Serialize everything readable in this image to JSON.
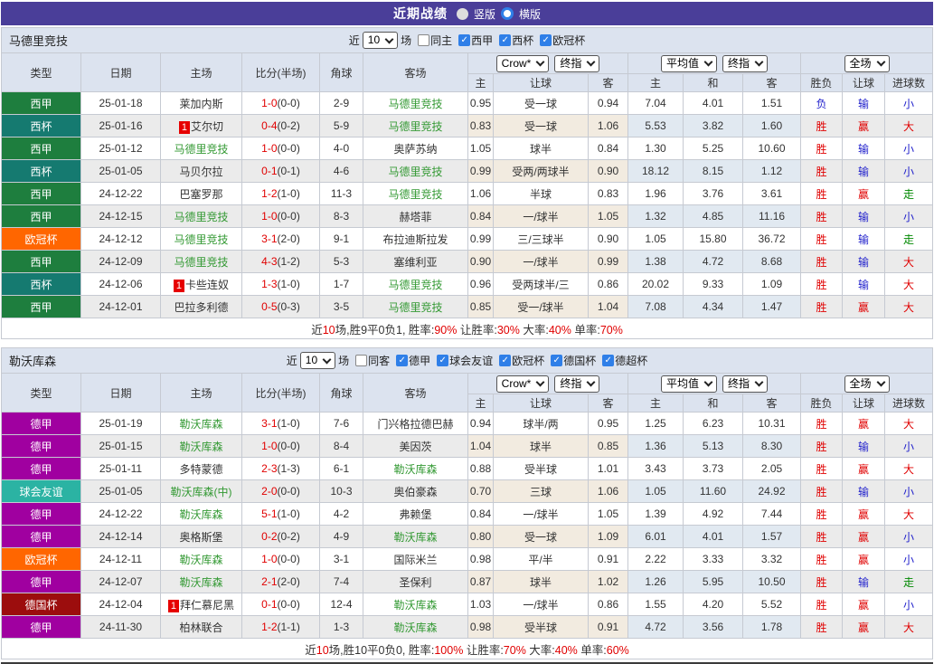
{
  "title_bar": {
    "title": "近期战绩",
    "options": [
      {
        "label": "竖版",
        "selected": false
      },
      {
        "label": "横版",
        "selected": true
      }
    ]
  },
  "colors": {
    "titlebar_bg": "#4a3e99",
    "accent_red": "#e00000",
    "accent_blue": "#2222cc",
    "accent_green": "#008800",
    "team_green": "#339933",
    "checkbox_blue": "#2f7fe8",
    "type_bg": {
      "西甲": "#1e7e3e",
      "西杯": "#157a70",
      "欧冠杯": "#ff6600",
      "德甲": "#a000a0",
      "球会友谊": "#2bb3a3",
      "德国杯": "#9c0d0d"
    }
  },
  "table_header": {
    "main_cols": [
      "类型",
      "日期",
      "主场",
      "比分(半场)",
      "角球",
      "客场"
    ],
    "groups": [
      {
        "dropdowns": [
          "Crow*",
          "终指"
        ],
        "sub": [
          "主",
          "让球",
          "客"
        ]
      },
      {
        "dropdowns": [
          "平均值",
          "终指"
        ],
        "sub": [
          "主",
          "和",
          "客"
        ]
      },
      {
        "dropdowns": [
          "全场"
        ],
        "sub": [
          "胜负",
          "让球",
          "进球数"
        ]
      }
    ]
  },
  "sections": [
    {
      "team": "马德里竞技",
      "filter": {
        "prefix": "近",
        "count": "10",
        "suffix": "场",
        "checkboxes": [
          {
            "label": "同主",
            "checked": false
          },
          {
            "label": "西甲",
            "checked": true
          },
          {
            "label": "西杯",
            "checked": true
          },
          {
            "label": "欧冠杯",
            "checked": true
          }
        ]
      },
      "rows": [
        {
          "type": "西甲",
          "date": "25-01-18",
          "home": "莱加内斯",
          "hb": 0,
          "hg": 0,
          "score": "1-0",
          "half": "(0-0)",
          "corner": "2-9",
          "away": "马德里竞技",
          "ag": 1,
          "o1": "0.95",
          "h": "受一球",
          "o2": "0.94",
          "a": [
            "7.04",
            "4.01",
            "1.51"
          ],
          "r": [
            "负",
            "输",
            "小"
          ],
          "rc": [
            "b",
            "b",
            "b"
          ]
        },
        {
          "type": "西杯",
          "date": "25-01-16",
          "home": "艾尔切",
          "hb": 1,
          "hg": 0,
          "score": "0-4",
          "half": "(0-2)",
          "corner": "5-9",
          "away": "马德里竞技",
          "ag": 1,
          "o1": "0.83",
          "h": "受一球",
          "o2": "1.06",
          "a": [
            "5.53",
            "3.82",
            "1.60"
          ],
          "r": [
            "胜",
            "赢",
            "大"
          ],
          "rc": [
            "r",
            "r",
            "r"
          ]
        },
        {
          "type": "西甲",
          "date": "25-01-12",
          "home": "马德里竞技",
          "hb": 0,
          "hg": 1,
          "score": "1-0",
          "half": "(0-0)",
          "corner": "4-0",
          "away": "奥萨苏纳",
          "ag": 0,
          "o1": "1.05",
          "h": "球半",
          "o2": "0.84",
          "a": [
            "1.30",
            "5.25",
            "10.60"
          ],
          "r": [
            "胜",
            "输",
            "小"
          ],
          "rc": [
            "r",
            "b",
            "b"
          ]
        },
        {
          "type": "西杯",
          "date": "25-01-05",
          "home": "马贝尔拉",
          "hb": 0,
          "hg": 0,
          "score": "0-1",
          "half": "(0-1)",
          "corner": "4-6",
          "away": "马德里竞技",
          "ag": 1,
          "o1": "0.99",
          "h": "受两/两球半",
          "o2": "0.90",
          "a": [
            "18.12",
            "8.15",
            "1.12"
          ],
          "r": [
            "胜",
            "输",
            "小"
          ],
          "rc": [
            "r",
            "b",
            "b"
          ]
        },
        {
          "type": "西甲",
          "date": "24-12-22",
          "home": "巴塞罗那",
          "hb": 0,
          "hg": 0,
          "score": "1-2",
          "half": "(1-0)",
          "corner": "11-3",
          "away": "马德里竞技",
          "ag": 1,
          "o1": "1.06",
          "h": "半球",
          "o2": "0.83",
          "a": [
            "1.96",
            "3.76",
            "3.61"
          ],
          "r": [
            "胜",
            "赢",
            "走"
          ],
          "rc": [
            "r",
            "r",
            "g"
          ]
        },
        {
          "type": "西甲",
          "date": "24-12-15",
          "home": "马德里竞技",
          "hb": 0,
          "hg": 1,
          "score": "1-0",
          "half": "(0-0)",
          "corner": "8-3",
          "away": "赫塔菲",
          "ag": 0,
          "o1": "0.84",
          "h": "一/球半",
          "o2": "1.05",
          "a": [
            "1.32",
            "4.85",
            "11.16"
          ],
          "r": [
            "胜",
            "输",
            "小"
          ],
          "rc": [
            "r",
            "b",
            "b"
          ]
        },
        {
          "type": "欧冠杯",
          "date": "24-12-12",
          "home": "马德里竞技",
          "hb": 0,
          "hg": 1,
          "score": "3-1",
          "half": "(2-0)",
          "corner": "9-1",
          "away": "布拉迪斯拉发",
          "ag": 0,
          "o1": "0.99",
          "h": "三/三球半",
          "o2": "0.90",
          "a": [
            "1.05",
            "15.80",
            "36.72"
          ],
          "r": [
            "胜",
            "输",
            "走"
          ],
          "rc": [
            "r",
            "b",
            "g"
          ]
        },
        {
          "type": "西甲",
          "date": "24-12-09",
          "home": "马德里竞技",
          "hb": 0,
          "hg": 1,
          "score": "4-3",
          "half": "(1-2)",
          "corner": "5-3",
          "away": "塞维利亚",
          "ag": 0,
          "o1": "0.90",
          "h": "一/球半",
          "o2": "0.99",
          "a": [
            "1.38",
            "4.72",
            "8.68"
          ],
          "r": [
            "胜",
            "输",
            "大"
          ],
          "rc": [
            "r",
            "b",
            "r"
          ]
        },
        {
          "type": "西杯",
          "date": "24-12-06",
          "home": "卡些连奴",
          "hb": 1,
          "hg": 0,
          "score": "1-3",
          "half": "(1-0)",
          "corner": "1-7",
          "away": "马德里竞技",
          "ag": 1,
          "o1": "0.96",
          "h": "受两球半/三",
          "o2": "0.86",
          "a": [
            "20.02",
            "9.33",
            "1.09"
          ],
          "r": [
            "胜",
            "输",
            "大"
          ],
          "rc": [
            "r",
            "b",
            "r"
          ]
        },
        {
          "type": "西甲",
          "date": "24-12-01",
          "home": "巴拉多利德",
          "hb": 0,
          "hg": 0,
          "score": "0-5",
          "half": "(0-3)",
          "corner": "3-5",
          "away": "马德里竞技",
          "ag": 1,
          "o1": "0.85",
          "h": "受一/球半",
          "o2": "1.04",
          "a": [
            "7.08",
            "4.34",
            "1.47"
          ],
          "r": [
            "胜",
            "赢",
            "大"
          ],
          "rc": [
            "r",
            "r",
            "r"
          ]
        }
      ],
      "summary": [
        [
          "近",
          "k"
        ],
        [
          "10",
          "r"
        ],
        [
          "场,胜9平0负1, 胜率:",
          "k"
        ],
        [
          "90%",
          "r"
        ],
        [
          " 让胜率:",
          "k"
        ],
        [
          "30%",
          "r"
        ],
        [
          " 大率:",
          "k"
        ],
        [
          "40%",
          "r"
        ],
        [
          " 单率:",
          "k"
        ],
        [
          "70%",
          "r"
        ]
      ]
    },
    {
      "team": "勒沃库森",
      "filter": {
        "prefix": "近",
        "count": "10",
        "suffix": "场",
        "checkboxes": [
          {
            "label": "同客",
            "checked": false
          },
          {
            "label": "德甲",
            "checked": true
          },
          {
            "label": "球会友谊",
            "checked": true
          },
          {
            "label": "欧冠杯",
            "checked": true
          },
          {
            "label": "德国杯",
            "checked": true
          },
          {
            "label": "德超杯",
            "checked": true
          }
        ]
      },
      "rows": [
        {
          "type": "德甲",
          "date": "25-01-19",
          "home": "勒沃库森",
          "hb": 0,
          "hg": 1,
          "score": "3-1",
          "half": "(1-0)",
          "corner": "7-6",
          "away": "门兴格拉德巴赫",
          "ag": 0,
          "o1": "0.94",
          "h": "球半/两",
          "o2": "0.95",
          "a": [
            "1.25",
            "6.23",
            "10.31"
          ],
          "r": [
            "胜",
            "赢",
            "大"
          ],
          "rc": [
            "r",
            "r",
            "r"
          ]
        },
        {
          "type": "德甲",
          "date": "25-01-15",
          "home": "勒沃库森",
          "hb": 0,
          "hg": 1,
          "score": "1-0",
          "half": "(0-0)",
          "corner": "8-4",
          "away": "美因茨",
          "ag": 0,
          "o1": "1.04",
          "h": "球半",
          "o2": "0.85",
          "a": [
            "1.36",
            "5.13",
            "8.30"
          ],
          "r": [
            "胜",
            "输",
            "小"
          ],
          "rc": [
            "r",
            "b",
            "b"
          ]
        },
        {
          "type": "德甲",
          "date": "25-01-11",
          "home": "多特蒙德",
          "hb": 0,
          "hg": 0,
          "score": "2-3",
          "half": "(1-3)",
          "corner": "6-1",
          "away": "勒沃库森",
          "ag": 1,
          "o1": "0.88",
          "h": "受半球",
          "o2": "1.01",
          "a": [
            "3.43",
            "3.73",
            "2.05"
          ],
          "r": [
            "胜",
            "赢",
            "大"
          ],
          "rc": [
            "r",
            "r",
            "r"
          ]
        },
        {
          "type": "球会友谊",
          "date": "25-01-05",
          "home": "勒沃库森(中)",
          "hb": 0,
          "hg": 1,
          "score": "2-0",
          "half": "(0-0)",
          "corner": "10-3",
          "away": "奥伯豪森",
          "ag": 0,
          "o1": "0.70",
          "h": "三球",
          "o2": "1.06",
          "a": [
            "1.05",
            "11.60",
            "24.92"
          ],
          "r": [
            "胜",
            "输",
            "小"
          ],
          "rc": [
            "r",
            "b",
            "b"
          ]
        },
        {
          "type": "德甲",
          "date": "24-12-22",
          "home": "勒沃库森",
          "hb": 0,
          "hg": 1,
          "score": "5-1",
          "half": "(1-0)",
          "corner": "4-2",
          "away": "弗赖堡",
          "ag": 0,
          "o1": "0.84",
          "h": "一/球半",
          "o2": "1.05",
          "a": [
            "1.39",
            "4.92",
            "7.44"
          ],
          "r": [
            "胜",
            "赢",
            "大"
          ],
          "rc": [
            "r",
            "r",
            "r"
          ]
        },
        {
          "type": "德甲",
          "date": "24-12-14",
          "home": "奥格斯堡",
          "hb": 0,
          "hg": 0,
          "score": "0-2",
          "half": "(0-2)",
          "corner": "4-9",
          "away": "勒沃库森",
          "ag": 1,
          "o1": "0.80",
          "h": "受一球",
          "o2": "1.09",
          "a": [
            "6.01",
            "4.01",
            "1.57"
          ],
          "r": [
            "胜",
            "赢",
            "小"
          ],
          "rc": [
            "r",
            "r",
            "b"
          ]
        },
        {
          "type": "欧冠杯",
          "date": "24-12-11",
          "home": "勒沃库森",
          "hb": 0,
          "hg": 1,
          "score": "1-0",
          "half": "(0-0)",
          "corner": "3-1",
          "away": "国际米兰",
          "ag": 0,
          "o1": "0.98",
          "h": "平/半",
          "o2": "0.91",
          "a": [
            "2.22",
            "3.33",
            "3.32"
          ],
          "r": [
            "胜",
            "赢",
            "小"
          ],
          "rc": [
            "r",
            "r",
            "b"
          ]
        },
        {
          "type": "德甲",
          "date": "24-12-07",
          "home": "勒沃库森",
          "hb": 0,
          "hg": 1,
          "score": "2-1",
          "half": "(2-0)",
          "corner": "7-4",
          "away": "圣保利",
          "ag": 0,
          "o1": "0.87",
          "h": "球半",
          "o2": "1.02",
          "a": [
            "1.26",
            "5.95",
            "10.50"
          ],
          "r": [
            "胜",
            "输",
            "走"
          ],
          "rc": [
            "r",
            "b",
            "g"
          ]
        },
        {
          "type": "德国杯",
          "date": "24-12-04",
          "home": "拜仁慕尼黑",
          "hb": 1,
          "hg": 0,
          "score": "0-1",
          "half": "(0-0)",
          "corner": "12-4",
          "away": "勒沃库森",
          "ag": 1,
          "o1": "1.03",
          "h": "一/球半",
          "o2": "0.86",
          "a": [
            "1.55",
            "4.20",
            "5.52"
          ],
          "r": [
            "胜",
            "赢",
            "小"
          ],
          "rc": [
            "r",
            "r",
            "b"
          ]
        },
        {
          "type": "德甲",
          "date": "24-11-30",
          "home": "柏林联合",
          "hb": 0,
          "hg": 0,
          "score": "1-2",
          "half": "(1-1)",
          "corner": "1-3",
          "away": "勒沃库森",
          "ag": 1,
          "o1": "0.98",
          "h": "受半球",
          "o2": "0.91",
          "a": [
            "4.72",
            "3.56",
            "1.78"
          ],
          "r": [
            "胜",
            "赢",
            "大"
          ],
          "rc": [
            "r",
            "r",
            "r"
          ]
        }
      ],
      "summary": [
        [
          "近",
          "k"
        ],
        [
          "10",
          "r"
        ],
        [
          "场,胜10平0负0, 胜率:",
          "k"
        ],
        [
          "100%",
          "r"
        ],
        [
          " 让胜率:",
          "k"
        ],
        [
          "70%",
          "r"
        ],
        [
          " 大率:",
          "k"
        ],
        [
          "40%",
          "r"
        ],
        [
          " 单率:",
          "k"
        ],
        [
          "60%",
          "r"
        ]
      ]
    }
  ]
}
